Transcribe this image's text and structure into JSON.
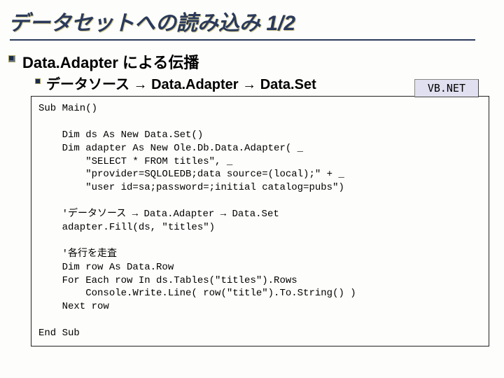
{
  "slide": {
    "title": "データセットへの読み込み 1/2",
    "section_heading": "Data.Adapter による伝播",
    "sub_heading": "データソース → Data.Adapter → Data.Set",
    "language_badge": "VB.NET",
    "code": "Sub Main()\n\n    Dim ds As New Data.Set()\n    Dim adapter As New Ole.Db.Data.Adapter( _\n        \"SELECT * FROM titles\", _\n        \"provider=SQLOLEDB;data source=(local);\" + _\n        \"user id=sa;password=;initial catalog=pubs\")\n\n    'データソース → Data.Adapter → Data.Set\n    adapter.Fill(ds, \"titles\")\n\n    '各行を走査\n    Dim row As Data.Row\n    For Each row In ds.Tables(\"titles\").Rows\n        Console.Write.Line( row(\"title\").To.String() )\n    Next row\n\nEnd Sub"
  }
}
